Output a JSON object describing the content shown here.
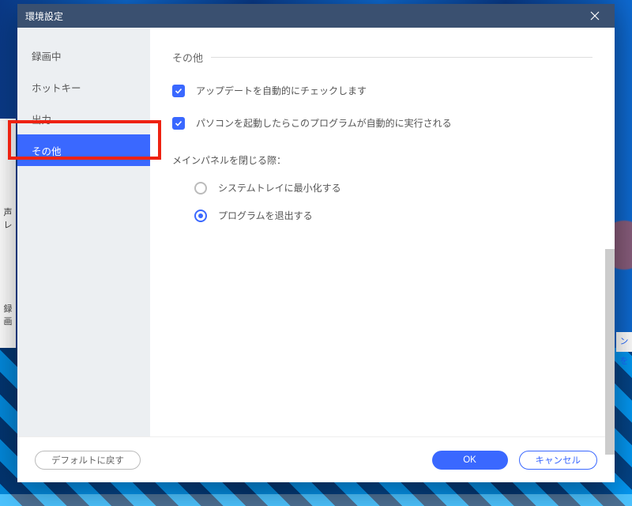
{
  "background": {
    "left_strip_top": "声レ",
    "left_strip_bottom": "録画",
    "right_strip": "ンを"
  },
  "dialog": {
    "title": "環境設定"
  },
  "sidebar": {
    "items": [
      {
        "label": "録画中"
      },
      {
        "label": "ホットキー"
      },
      {
        "label": "出力"
      },
      {
        "label": "その他"
      }
    ],
    "active_index": 3
  },
  "panel": {
    "heading": "その他",
    "checkbox1_label": "アップデートを自動的にチェックします",
    "checkbox1_checked": true,
    "checkbox2_label": "パソコンを起動したらこのプログラムが自動的に実行される",
    "checkbox2_checked": true,
    "close_behavior_label": "メインパネルを閉じる際：",
    "radio1_label": "システムトレイに最小化する",
    "radio2_label": "プログラムを退出する",
    "radio_selected": 2
  },
  "footer": {
    "reset_label": "デフォルトに戻す",
    "ok_label": "OK",
    "cancel_label": "キャンセル"
  }
}
